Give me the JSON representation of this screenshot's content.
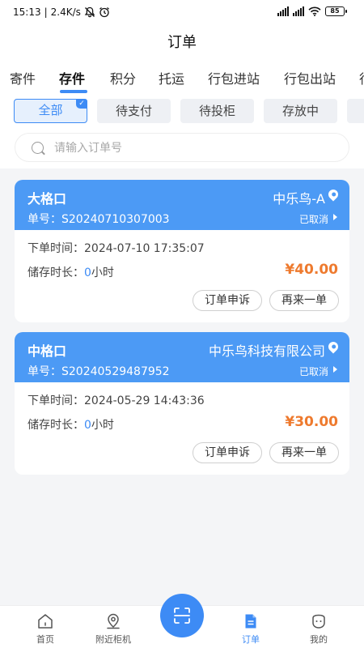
{
  "status_bar": {
    "time": "15:13",
    "speed": "2.4K/s",
    "battery": "85"
  },
  "page_title": "订单",
  "tabs": [
    {
      "label": "寄件"
    },
    {
      "label": "存件"
    },
    {
      "label": "积分"
    },
    {
      "label": "托运"
    },
    {
      "label": "行包进站"
    },
    {
      "label": "行包出站"
    },
    {
      "label": "行"
    }
  ],
  "filters": [
    {
      "label": "全部"
    },
    {
      "label": "待支付"
    },
    {
      "label": "待投柜"
    },
    {
      "label": "存放中"
    },
    {
      "label": ""
    }
  ],
  "search": {
    "placeholder": "请输入订单号"
  },
  "orders": [
    {
      "type": "大格口",
      "location": "中乐鸟-A",
      "order_no": "单号：S20240710307003",
      "status": "已取消",
      "time": "下单时间：2024-07-10 17:35:07",
      "duration_label": "储存时长：",
      "duration_value": "0",
      "duration_unit": "小时",
      "price": "¥40.00",
      "btn_appeal": "订单申诉",
      "btn_again": "再来一单"
    },
    {
      "type": "中格口",
      "location": "中乐鸟科技有限公司",
      "order_no": "单号：S20240529487952",
      "status": "已取消",
      "time": "下单时间：2024-05-29 14:43:36",
      "duration_label": "储存时长：",
      "duration_value": "0",
      "duration_unit": "小时",
      "price": "¥30.00",
      "btn_appeal": "订单申诉",
      "btn_again": "再来一单"
    }
  ],
  "bottom_nav": [
    {
      "label": "首页"
    },
    {
      "label": "附近柜机"
    },
    {
      "label": "订单"
    },
    {
      "label": "我的"
    }
  ],
  "colors": {
    "accent": "#3d8bf5",
    "card_header": "#4c9af5",
    "price": "#ee7a2e"
  }
}
